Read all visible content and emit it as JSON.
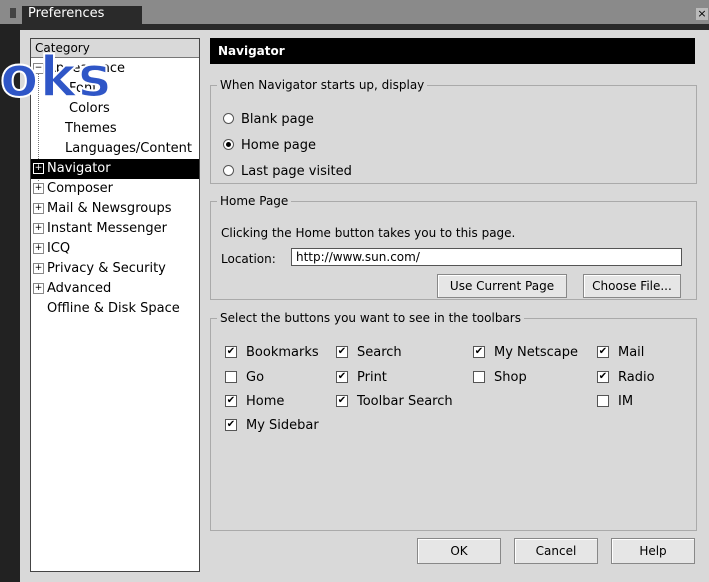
{
  "window": {
    "title": "Preferences",
    "close_glyph": "×"
  },
  "background": {
    "overlay_text": "oks"
  },
  "sidebar": {
    "header": "Category",
    "items": [
      {
        "label": "Appearance",
        "expander": "⊟",
        "level": 0
      },
      {
        "label": "Fonts",
        "level": 1
      },
      {
        "label": "Colors",
        "level": 1
      },
      {
        "label": "Themes",
        "level": 1
      },
      {
        "label": "Languages/Content",
        "level": 1
      },
      {
        "label": "Navigator",
        "expander": "+",
        "level": 0,
        "selected": true
      },
      {
        "label": "Composer",
        "expander": "+",
        "level": 0
      },
      {
        "label": "Mail & Newsgroups",
        "expander": "+",
        "level": 0
      },
      {
        "label": "Instant Messenger",
        "expander": "+",
        "level": 0
      },
      {
        "label": "ICQ",
        "expander": "+",
        "level": 0
      },
      {
        "label": "Privacy & Security",
        "expander": "+",
        "level": 0
      },
      {
        "label": "Advanced",
        "expander": "+",
        "level": 0
      },
      {
        "label": "Offline & Disk Space",
        "level": 0
      }
    ]
  },
  "main": {
    "header": "Navigator",
    "startup": {
      "legend": "When Navigator starts up, display",
      "options": [
        {
          "label": "Blank page",
          "checked": false
        },
        {
          "label": "Home page",
          "checked": true
        },
        {
          "label": "Last page visited",
          "checked": false
        }
      ]
    },
    "homepage": {
      "legend": "Home Page",
      "description": "Clicking the Home button takes you to this page.",
      "location_label": "Location:",
      "location_value": "http://www.sun.com/",
      "use_current_label": "Use Current Page",
      "choose_file_label": "Choose File..."
    },
    "toolbars": {
      "legend": "Select the buttons you want to see in the toolbars",
      "checkboxes": [
        {
          "label": "Bookmarks",
          "checked": true
        },
        {
          "label": "Search",
          "checked": true
        },
        {
          "label": "My Netscape",
          "checked": true
        },
        {
          "label": "Mail",
          "checked": true
        },
        {
          "label": "Go",
          "checked": false
        },
        {
          "label": "Print",
          "checked": true
        },
        {
          "label": "Shop",
          "checked": false
        },
        {
          "label": "Radio",
          "checked": true
        },
        {
          "label": "Home",
          "checked": true
        },
        {
          "label": "Toolbar Search",
          "checked": true
        },
        {
          "label": "IM",
          "checked": false
        },
        {
          "label": "My Sidebar",
          "checked": true
        }
      ]
    }
  },
  "buttons": {
    "ok": "OK",
    "cancel": "Cancel",
    "help": "Help"
  },
  "glyphs": {
    "check": "✔"
  }
}
